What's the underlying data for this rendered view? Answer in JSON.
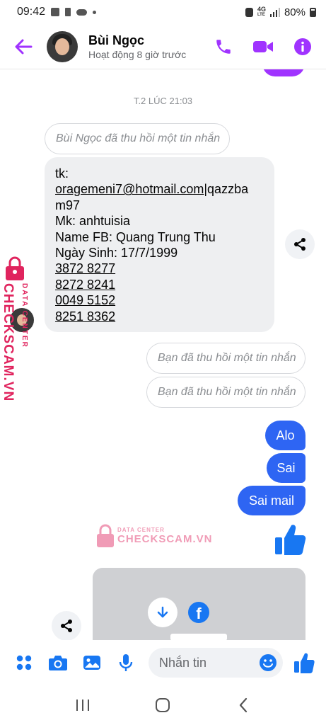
{
  "status_bar": {
    "time": "09:42",
    "network": "4G",
    "network_sub": "LTE",
    "battery": "80%"
  },
  "header": {
    "contact_name": "Bùi Ngọc",
    "presence": "Hoạt động 8 giờ trước"
  },
  "chat": {
    "timestamp": "T.2 LÚC 21:03",
    "recalled_incoming": "Bùi Ngọc đã thu hồi một tin nhắn",
    "incoming_message": {
      "line1": "tk:",
      "email": "oragemeni7@hotmail.com",
      "email_suffix": "|qazzba",
      "line3": "m97",
      "line4": "Mk: anhtuisia",
      "line5": "Name FB: Quang Trung Thu",
      "line6": "Ngày Sinh: 17/7/1999",
      "phones": [
        "3872 8277",
        "8272 8241",
        "0049 5152",
        "8251 8362"
      ]
    },
    "recalled_outgoing": [
      "Bạn đã thu hồi một tin nhắn",
      "Bạn đã thu hồi một tin nhắn"
    ],
    "outgoing_messages": [
      "Alo",
      "Sai",
      "Sai mail"
    ]
  },
  "watermark": {
    "small": "DATA CENTER",
    "big": "CHECKSCAM.VN"
  },
  "composer": {
    "placeholder": "Nhắn tin"
  },
  "colors": {
    "accent_purple": "#a033ff",
    "outgoing_bubble": "#2e65f3",
    "incoming_bubble": "#eeeff1",
    "icon_blue": "#1877f2",
    "watermark_pink": "#e0245e"
  }
}
